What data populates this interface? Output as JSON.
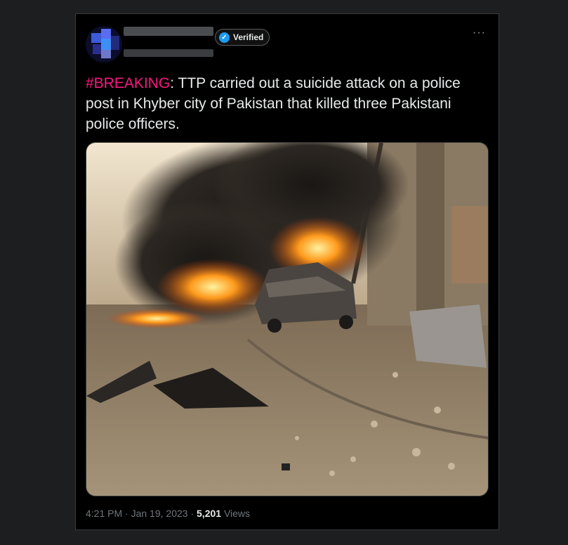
{
  "author": {
    "verified_label": "Verified"
  },
  "menu": {
    "more_icon": "···"
  },
  "tweet": {
    "hashtag": "#BREAKING",
    "text": ": TTP carried out a suicide attack on a police post in Khyber city of Pakistan that killed three Pakistani police officers."
  },
  "meta": {
    "time": "4:21 PM",
    "sep1": " · ",
    "date": "Jan 19, 2023",
    "sep2": " · ",
    "views_count": "5,201",
    "views_label": " Views"
  },
  "colors": {
    "hashtag": "#f91880",
    "verified_badge": "#1d9bf0",
    "background": "#000000"
  }
}
